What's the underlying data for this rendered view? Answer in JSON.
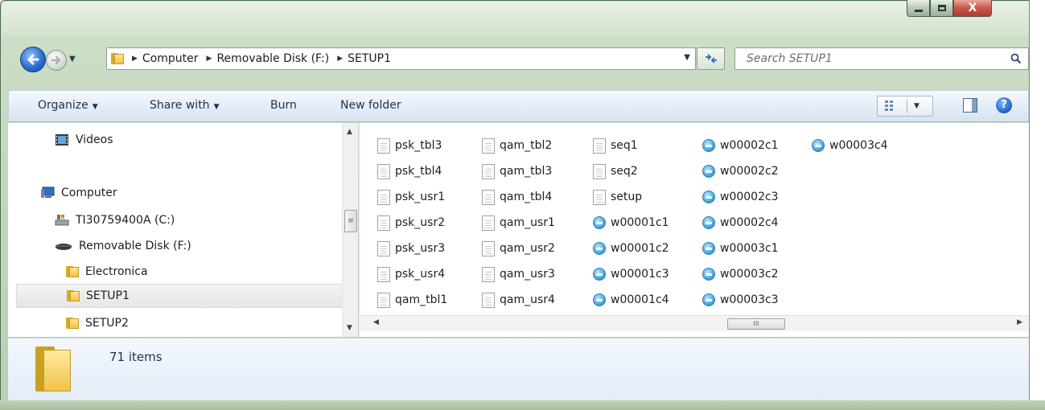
{
  "window": {
    "controls": {
      "minimize": "minimize",
      "maximize": "maximize",
      "close": "X"
    }
  },
  "address": {
    "crumbs": [
      "Computer",
      "Removable Disk (F:)",
      "SETUP1"
    ]
  },
  "search": {
    "placeholder": "Search SETUP1"
  },
  "command_bar": {
    "organize": "Organize",
    "share_with": "Share with",
    "burn": "Burn",
    "new_folder": "New folder",
    "help": "?"
  },
  "nav_pane": {
    "items": [
      {
        "label": "Videos",
        "icon": "videos-icon"
      },
      {
        "label": "Computer",
        "icon": "computer-icon"
      },
      {
        "label": "TI30759400A (C:)",
        "icon": "windows-drive-icon"
      },
      {
        "label": "Removable Disk (F:)",
        "icon": "removable-disk-icon"
      },
      {
        "label": "Electronica",
        "icon": "folder-icon"
      },
      {
        "label": "SETUP1",
        "icon": "folder-icon",
        "selected": true
      },
      {
        "label": "SETUP2",
        "icon": "folder-icon"
      }
    ]
  },
  "files": {
    "columns": [
      [
        {
          "name": "psk_tbl3",
          "type": "document"
        },
        {
          "name": "psk_tbl4",
          "type": "document"
        },
        {
          "name": "psk_usr1",
          "type": "document"
        },
        {
          "name": "psk_usr2",
          "type": "document"
        },
        {
          "name": "psk_usr3",
          "type": "document"
        },
        {
          "name": "psk_usr4",
          "type": "document"
        },
        {
          "name": "qam_tbl1",
          "type": "document"
        }
      ],
      [
        {
          "name": "qam_tbl2",
          "type": "document"
        },
        {
          "name": "qam_tbl3",
          "type": "document"
        },
        {
          "name": "qam_tbl4",
          "type": "document"
        },
        {
          "name": "qam_usr1",
          "type": "document"
        },
        {
          "name": "qam_usr2",
          "type": "document"
        },
        {
          "name": "qam_usr3",
          "type": "document"
        },
        {
          "name": "qam_usr4",
          "type": "document"
        }
      ],
      [
        {
          "name": "seq1",
          "type": "document"
        },
        {
          "name": "seq2",
          "type": "document"
        },
        {
          "name": "setup",
          "type": "document"
        },
        {
          "name": "w00001c1",
          "type": "app"
        },
        {
          "name": "w00001c2",
          "type": "app"
        },
        {
          "name": "w00001c3",
          "type": "app"
        },
        {
          "name": "w00001c4",
          "type": "app"
        }
      ],
      [
        {
          "name": "w00002c1",
          "type": "app"
        },
        {
          "name": "w00002c2",
          "type": "app"
        },
        {
          "name": "w00002c3",
          "type": "app"
        },
        {
          "name": "w00002c4",
          "type": "app"
        },
        {
          "name": "w00003c1",
          "type": "app"
        },
        {
          "name": "w00003c2",
          "type": "app"
        },
        {
          "name": "w00003c3",
          "type": "app"
        }
      ],
      [
        {
          "name": "w00003c4",
          "type": "app"
        }
      ]
    ]
  },
  "status": {
    "item_count": "71 items"
  },
  "scrollbar": {
    "thumb_grip": "III"
  }
}
